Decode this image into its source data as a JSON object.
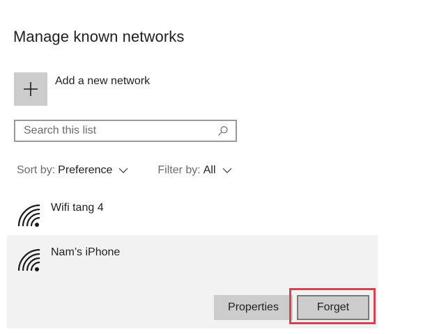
{
  "page": {
    "title": "Manage known networks"
  },
  "add_network": {
    "label": "Add a new network",
    "icon": "plus-icon"
  },
  "search": {
    "placeholder": "Search this list",
    "value": "",
    "icon": "search-icon"
  },
  "sort": {
    "key_label": "Sort by:",
    "value": "Preference",
    "icon": "chevron-down-icon"
  },
  "filter": {
    "key_label": "Filter by:",
    "value": "All",
    "icon": "chevron-down-icon"
  },
  "networks": [
    {
      "name": "Wifi tang 4",
      "icon": "wifi-icon",
      "selected": false
    },
    {
      "name": "Nam’s iPhone",
      "icon": "wifi-icon",
      "selected": true
    }
  ],
  "selected_actions": {
    "properties_label": "Properties",
    "forget_label": "Forget"
  },
  "colors": {
    "highlight": "#d0454f",
    "selected_bg": "#f2f2f2",
    "button_bg": "#cccccc"
  }
}
